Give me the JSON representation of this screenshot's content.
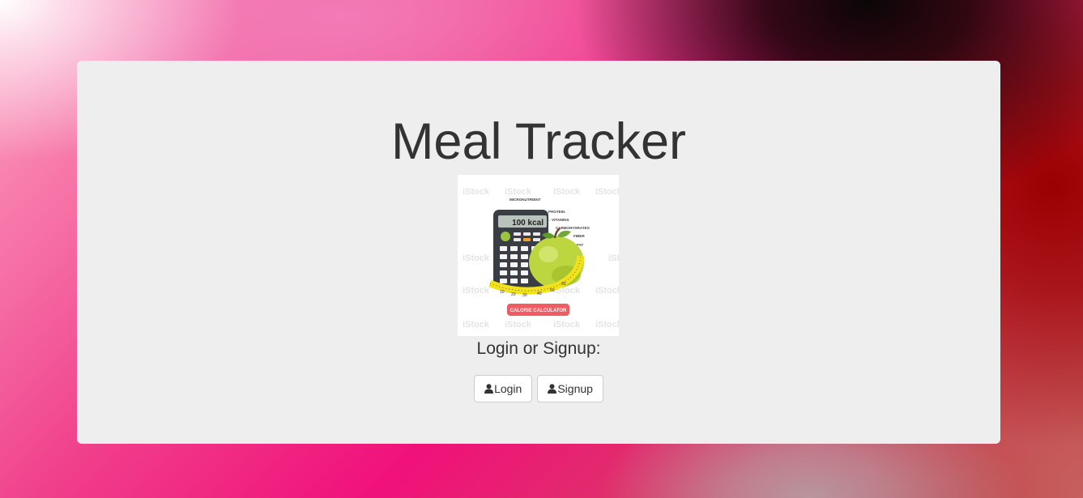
{
  "page": {
    "title": "Meal Tracker",
    "subtitle": "Login or Signup:"
  },
  "image": {
    "alt": "calorie calculator illustration",
    "display_value": "100 kcal",
    "labels": [
      "MICRONUTRIENT",
      "PROTEIN",
      "VITAMINS",
      "CARBOHYDRATES",
      "FIBER",
      "FAT"
    ],
    "banner": "CALORIE CALCULATOR",
    "watermark": "iStock"
  },
  "buttons": {
    "login_label": "Login",
    "signup_label": "Signup",
    "icon": "user-icon"
  },
  "colors": {
    "card_background": "#eeeeee",
    "text": "#333333",
    "banner_red": "#f05c62",
    "apple_green": "#b8d43a",
    "tape_yellow": "#f2e21a"
  }
}
